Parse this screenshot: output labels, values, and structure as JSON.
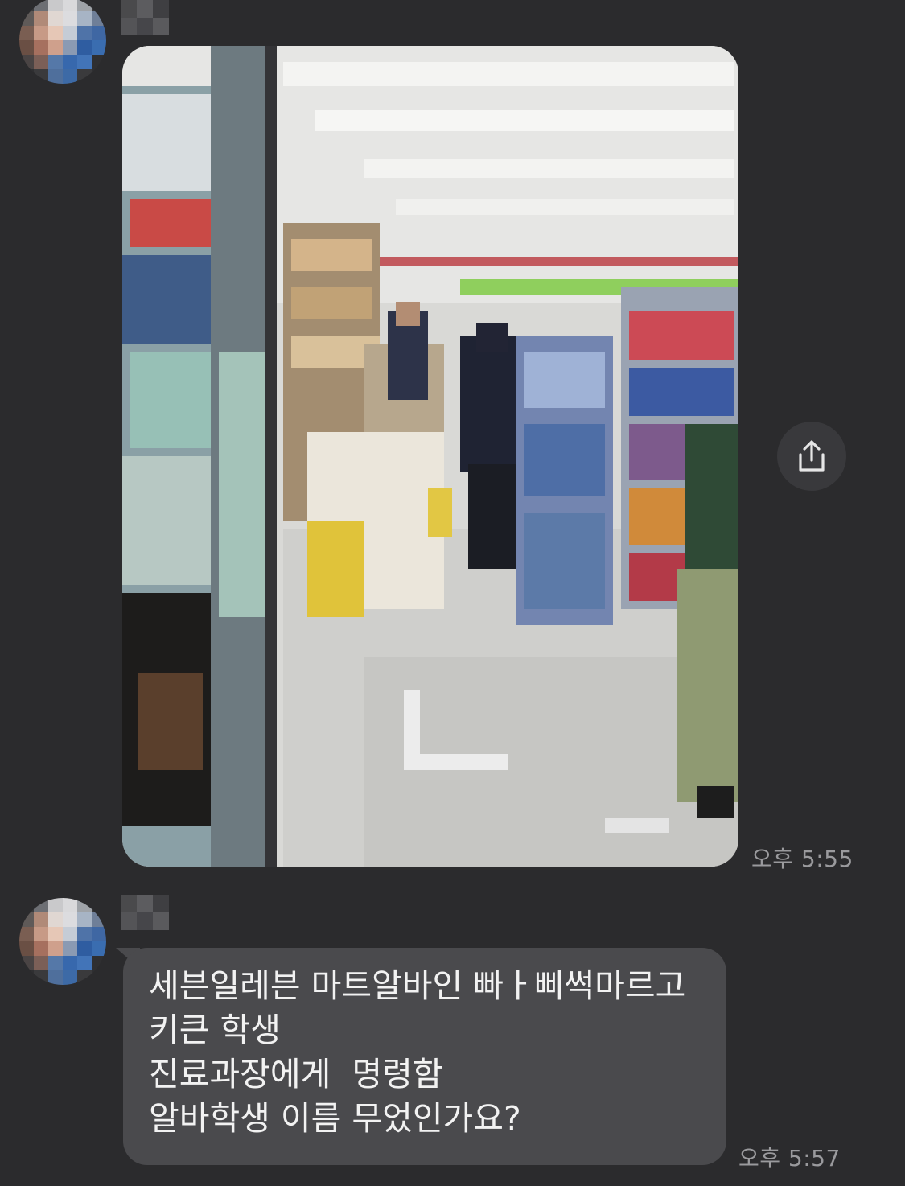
{
  "messages": [
    {
      "sender": "",
      "type": "photo",
      "photo_alt": "",
      "time": "오후 5:55",
      "share_icon": "share-icon"
    },
    {
      "sender": "",
      "type": "text",
      "lines": [
        "세븐일레븐 마트알바인 빠ㅏ삐썩마르고",
        "키큰 학생",
        "진료과장에게  명령함",
        "알바학생 이름 무었인가요?"
      ],
      "time": "오후 5:57"
    }
  ],
  "colors": {
    "background": "#2b2b2d",
    "bubble": "#4a4a4d",
    "text": "#f2f2f2",
    "timestamp": "#9a9a9d",
    "share_button": "#39393c"
  }
}
